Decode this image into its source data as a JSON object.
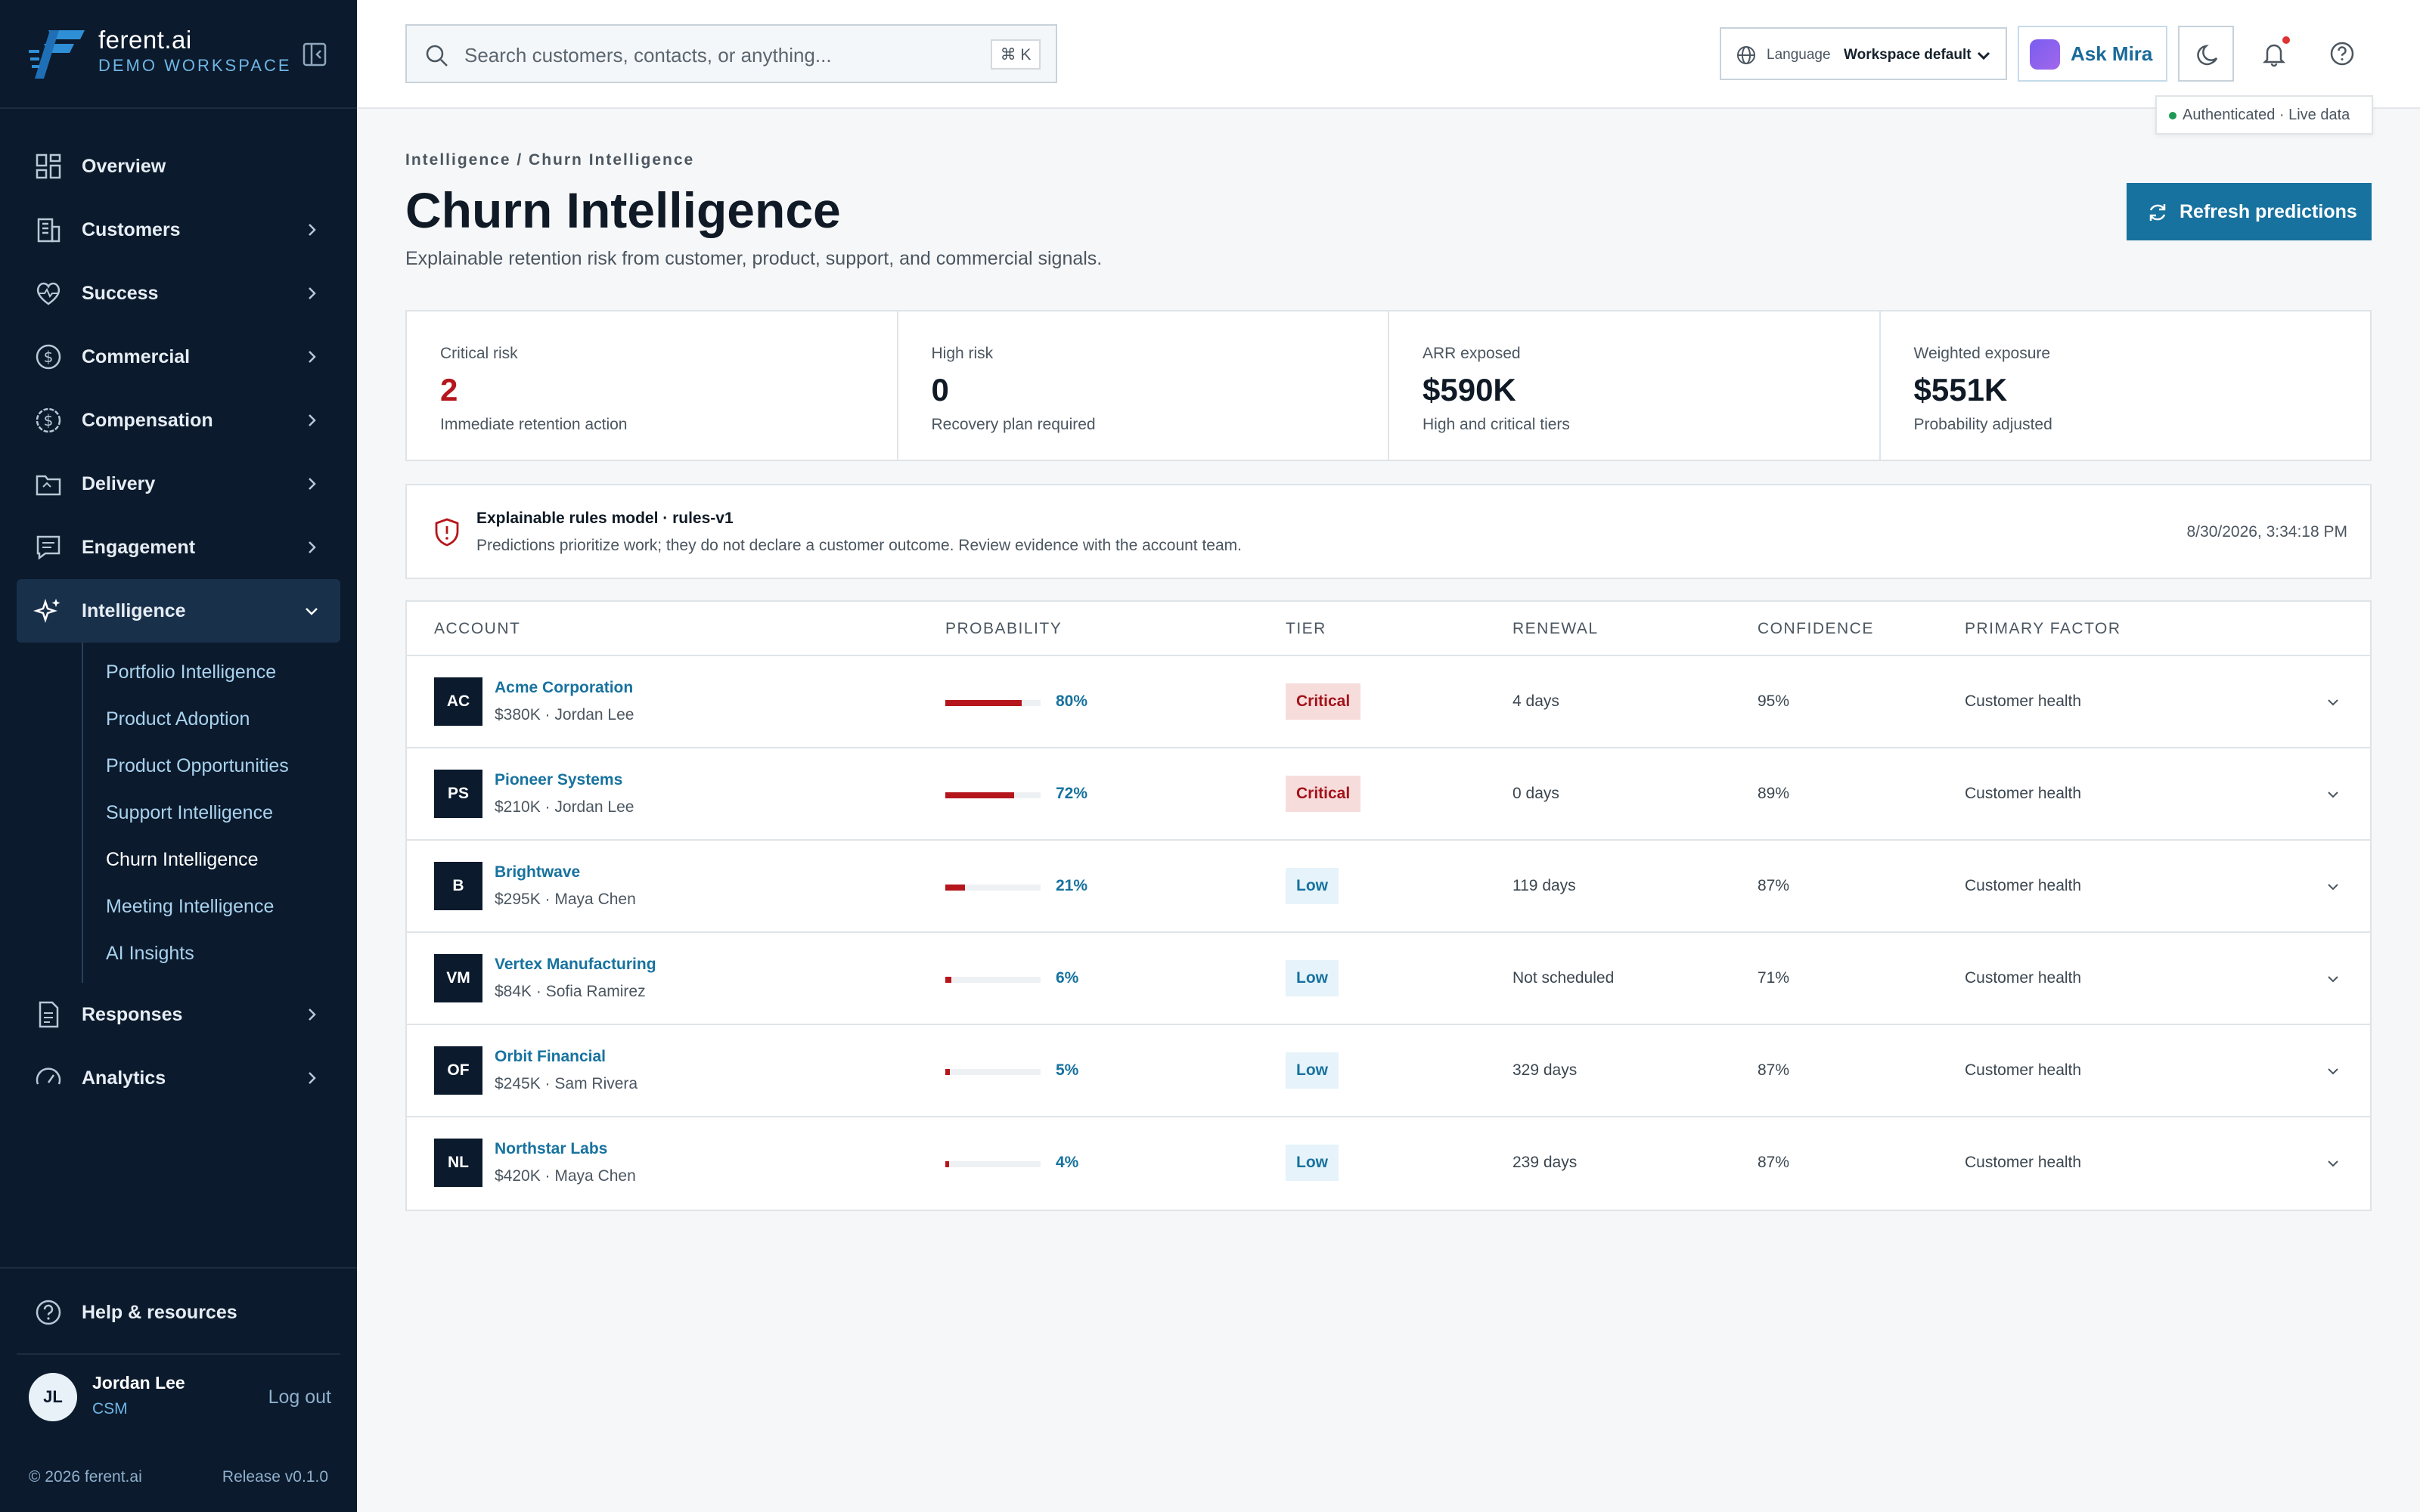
{
  "brand": {
    "name": "ferent.ai",
    "workspace": "DEMO WORKSPACE"
  },
  "sidebar": {
    "items": [
      {
        "label": "Overview",
        "icon": "grid-icon"
      },
      {
        "label": "Customers",
        "icon": "building-icon"
      },
      {
        "label": "Success",
        "icon": "heart-pulse-icon"
      },
      {
        "label": "Commercial",
        "icon": "dollar-circle-icon"
      },
      {
        "label": "Compensation",
        "icon": "dollar-badge-icon"
      },
      {
        "label": "Delivery",
        "icon": "folder-icon"
      },
      {
        "label": "Engagement",
        "icon": "message-square-icon"
      },
      {
        "label": "Intelligence",
        "icon": "sparkles-icon"
      },
      {
        "label": "Responses",
        "icon": "file-text-icon"
      },
      {
        "label": "Analytics",
        "icon": "gauge-icon"
      }
    ],
    "intelligence_sub": [
      "Portfolio Intelligence",
      "Product Adoption",
      "Product Opportunities",
      "Support Intelligence",
      "Churn Intelligence",
      "Meeting Intelligence",
      "AI Insights"
    ],
    "help_label": "Help & resources",
    "user": {
      "initials": "JL",
      "name": "Jordan Lee",
      "role": "CSM",
      "logout": "Log out"
    },
    "footer": {
      "copyright": "© 2026 ferent.ai",
      "release": "Release v0.1.0"
    }
  },
  "topbar": {
    "search_placeholder": "Search customers, contacts, or anything...",
    "shortcut": "⌘ K",
    "language_label": "Language",
    "language_value": "Workspace default",
    "ask_label": "Ask Mira",
    "auth_status": "Authenticated · Live data"
  },
  "page": {
    "breadcrumb": "Intelligence / Churn Intelligence",
    "title": "Churn Intelligence",
    "subtitle": "Explainable retention risk from customer, product, support, and commercial signals.",
    "refresh_label": "Refresh predictions"
  },
  "kpis": [
    {
      "label": "Critical risk",
      "value": "2",
      "sub": "Immediate retention action"
    },
    {
      "label": "High risk",
      "value": "0",
      "sub": "Recovery plan required"
    },
    {
      "label": "ARR exposed",
      "value": "$590K",
      "sub": "High and critical tiers"
    },
    {
      "label": "Weighted exposure",
      "value": "$551K",
      "sub": "Probability adjusted"
    }
  ],
  "notice": {
    "title": "Explainable rules model · rules-v1",
    "text": "Predictions prioritize work; they do not declare a customer outcome. Review evidence with the account team.",
    "timestamp": "8/30/2026, 3:34:18 PM"
  },
  "table": {
    "headers": [
      "ACCOUNT",
      "PROBABILITY",
      "TIER",
      "RENEWAL",
      "CONFIDENCE",
      "PRIMARY FACTOR"
    ],
    "rows": [
      {
        "initials": "AC",
        "name": "Acme Corporation",
        "meta": "$380K · Jordan Lee",
        "probability": 0.8,
        "probability_label": "80%",
        "tier": "Critical",
        "renewal": "4 days",
        "confidence": "95%",
        "factor": "Customer health"
      },
      {
        "initials": "PS",
        "name": "Pioneer Systems",
        "meta": "$210K · Jordan Lee",
        "probability": 0.72,
        "probability_label": "72%",
        "tier": "Critical",
        "renewal": "0 days",
        "confidence": "89%",
        "factor": "Customer health"
      },
      {
        "initials": "B",
        "name": "Brightwave",
        "meta": "$295K · Maya Chen",
        "probability": 0.21,
        "probability_label": "21%",
        "tier": "Low",
        "renewal": "119 days",
        "confidence": "87%",
        "factor": "Customer health"
      },
      {
        "initials": "VM",
        "name": "Vertex Manufacturing",
        "meta": "$84K · Sofia Ramirez",
        "probability": 0.06,
        "probability_label": "6%",
        "tier": "Low",
        "renewal": "Not scheduled",
        "confidence": "71%",
        "factor": "Customer health"
      },
      {
        "initials": "OF",
        "name": "Orbit Financial",
        "meta": "$245K · Sam Rivera",
        "probability": 0.05,
        "probability_label": "5%",
        "tier": "Low",
        "renewal": "329 days",
        "confidence": "87%",
        "factor": "Customer health"
      },
      {
        "initials": "NL",
        "name": "Northstar Labs",
        "meta": "$420K · Maya Chen",
        "probability": 0.04,
        "probability_label": "4%",
        "tier": "Low",
        "renewal": "239 days",
        "confidence": "87%",
        "factor": "Customer health"
      }
    ]
  },
  "colors": {
    "sidebar_bg": "#0b1a2c",
    "accent": "#17729f",
    "critical": "#b5161c",
    "low": "#17729f"
  }
}
